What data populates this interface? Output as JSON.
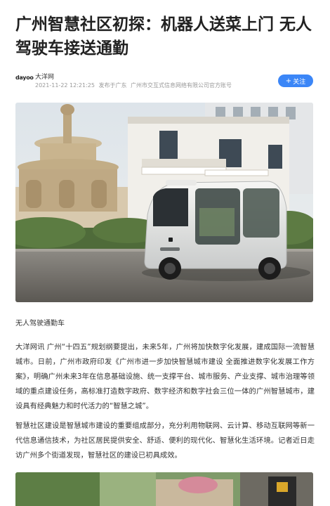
{
  "article": {
    "title": "广州智慧社区初探：机器人送菜上门 无人驾驶车接送通勤",
    "author": {
      "avatar_text": "dayoo",
      "name": "大洋网",
      "date": "2021-11-22 12:21:25",
      "location": "发布于广东",
      "org": "广州市交互式信息网络有限公司官方账号"
    },
    "follow_label": "关注",
    "image_caption": "无人驾驶通勤车",
    "paragraphs": [
      "大洋网讯 广州“十四五”规划纲要提出，未来5年，广州将加快数字化发展，建成国际一流智慧城市。日前，广州市政府印发《广州市进一步加快智慧城市建设 全面推进数字化发展工作方案》，明确广州未来3年在信息基础设施、统一支撑平台、城市服务、产业支撑、城市治理等领域的重点建设任务，高标准打造数字政府、数字经济和数字社会三位一体的广州智慧城市，建设具有经典魅力和时代活力的“智慧之城”。",
      "智慧社区建设是智慧城市建设的重要组成部分，充分利用物联网、云计算、移动互联网等新一代信息通信技术，为社区居民提供安全、舒适、便利的现代化、智慧化生活环境。记者近日走访广州多个街道发现，智慧社区的建设已初具成效。"
    ]
  },
  "icons": {
    "follow": "plus-icon"
  },
  "colors": {
    "accent": "#3b86f7"
  }
}
